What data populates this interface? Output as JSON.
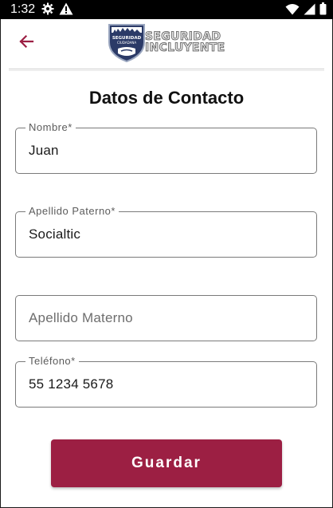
{
  "status_bar": {
    "time": "1:32",
    "left_icons": [
      "gear-icon",
      "warning-icon"
    ],
    "right_icons": [
      "wifi-icon",
      "signal-icon",
      "battery-icon"
    ]
  },
  "app_bar": {
    "back_icon": "arrow-left-icon",
    "logo": {
      "line1": "SEGURIDAD",
      "line2": "INCLUYENTE",
      "badge_line1": "SEGURIDAD",
      "badge_line2": "CIUDADANA"
    }
  },
  "page": {
    "title": "Datos de Contacto"
  },
  "form": {
    "nombre": {
      "label": "Nombre*",
      "value": "Juan",
      "placeholder": ""
    },
    "apellido_paterno": {
      "label": "Apellido Paterno*",
      "value": "Socialtic",
      "placeholder": ""
    },
    "apellido_materno": {
      "label": "",
      "value": "",
      "placeholder": "Apellido Materno"
    },
    "telefono": {
      "label": "Teléfono*",
      "value": "55 1234 5678",
      "placeholder": ""
    }
  },
  "actions": {
    "save_label": "Guardar"
  },
  "colors": {
    "accent": "#9c1f43",
    "border": "#7a7a7a",
    "status_bar": "#000000"
  }
}
